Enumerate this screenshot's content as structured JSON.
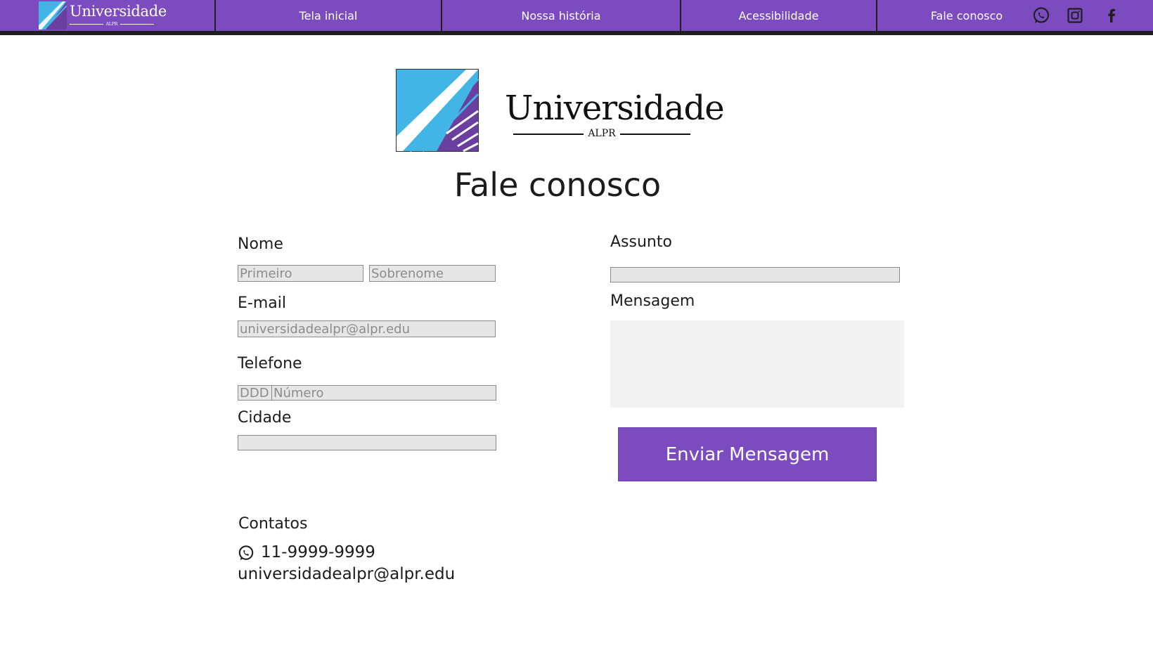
{
  "navbar": {
    "logo": {
      "title": "Universidade",
      "subtitle": "ALPR"
    },
    "items": [
      {
        "label": "Tela inicial"
      },
      {
        "label": "Nossa história"
      },
      {
        "label": "Acessibilidade"
      },
      {
        "label": "Fale conosco"
      }
    ],
    "social_icons": [
      "whatsapp-icon",
      "instagram-icon",
      "facebook-icon"
    ]
  },
  "brand": {
    "title": "Universidade",
    "subtitle": "ALPR",
    "colors": {
      "purple": "#7b4bbf",
      "light_blue": "#41b6e6",
      "dark_purple": "#6a3fa0"
    }
  },
  "page": {
    "title": "Fale conosco"
  },
  "form": {
    "name": {
      "label": "Nome",
      "first_placeholder": "Primeiro",
      "last_placeholder": "Sobrenome"
    },
    "email": {
      "label": "E-mail",
      "placeholder": "universidadealpr@alpr.edu"
    },
    "phone": {
      "label": "Telefone",
      "ddd_placeholder": "DDD",
      "number_placeholder": "Número"
    },
    "city": {
      "label": "Cidade",
      "placeholder": ""
    },
    "subject": {
      "label": "Assunto",
      "placeholder": ""
    },
    "message": {
      "label": "Mensagem",
      "placeholder": ""
    },
    "submit_label": "Enviar Mensagem"
  },
  "contacts": {
    "title": "Contatos",
    "phone": "11-9999-9999",
    "email": "universidadealpr@alpr.edu"
  }
}
